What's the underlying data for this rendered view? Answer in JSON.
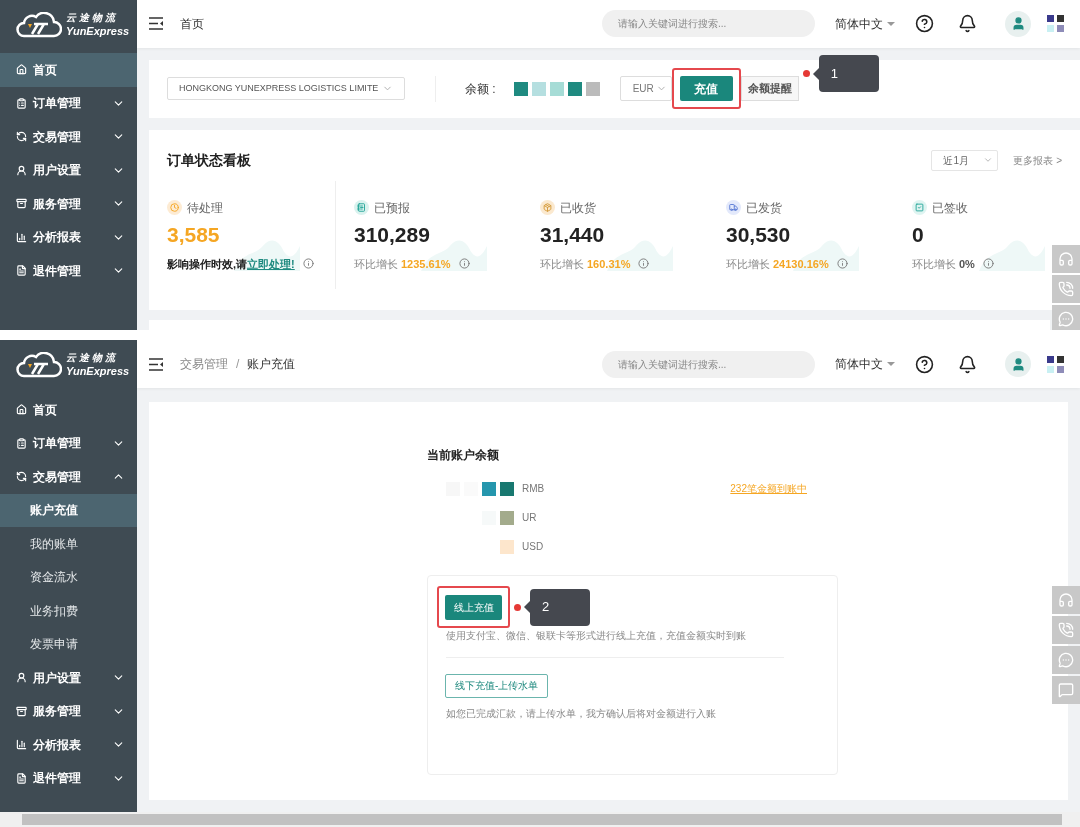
{
  "home_screen": {
    "logo": {
      "name_cn": "云途物流",
      "name_en": "YunExpress"
    },
    "sidebar": [
      {
        "label": "首页",
        "selected": true
      },
      {
        "label": "订单管理",
        "selected": false,
        "expanded": false
      },
      {
        "label": "交易管理",
        "selected": false,
        "expanded": false
      },
      {
        "label": "用户设置",
        "selected": false,
        "expanded": false
      },
      {
        "label": "服务管理",
        "selected": false,
        "expanded": false
      },
      {
        "label": "分析报表",
        "selected": false,
        "expanded": false
      },
      {
        "label": "退件管理",
        "selected": false,
        "expanded": false
      }
    ],
    "header": {
      "breadcrumb": [
        "首页"
      ],
      "search": {
        "placeholder": "请输入关键词进行搜索..."
      },
      "language": "简体中文"
    },
    "account_bar": {
      "company": "HONGKONG YUNEXPRESS LOGISTICS LIMITE",
      "balance_label": "余额 :",
      "currency": "EUR",
      "recharge_button": {
        "label": "充值",
        "highlighted": true
      },
      "reminder_button": "余额提醒",
      "callout": "1"
    },
    "dashboard": {
      "title": "订单状态看板",
      "period": "近1月",
      "more_link": "更多报表 >",
      "stats": [
        {
          "kind": "pending",
          "label": "待处理",
          "value": "3,585",
          "note": "影响操作时效,请",
          "link": "立即处理!"
        },
        {
          "kind": "growth",
          "label": "已预报",
          "value": "310,289",
          "growth_label": "环比增长",
          "growth": "1235.61%",
          "highlighted": true
        },
        {
          "kind": "growth",
          "label": "已收货",
          "value": "31,440",
          "growth_label": "环比增长",
          "growth": "160.31%",
          "highlighted": true
        },
        {
          "kind": "growth",
          "label": "已发货",
          "value": "30,530",
          "growth_label": "环比增长",
          "growth": "24130.16%",
          "highlighted": true
        },
        {
          "kind": "growth",
          "label": "已签收",
          "value": "0",
          "growth_label": "环比增长",
          "growth": "0%",
          "highlighted": false
        }
      ]
    }
  },
  "recharge_screen": {
    "logo": {
      "name_cn": "云途物流",
      "name_en": "YunExpress"
    },
    "sidebar": [
      {
        "label": "首页",
        "selected": false
      },
      {
        "label": "订单管理",
        "selected": false,
        "expanded": false
      },
      {
        "label": "交易管理",
        "selected": false,
        "expanded": true,
        "children": [
          {
            "label": "账户充值",
            "selected": true
          },
          {
            "label": "我的账单",
            "selected": false
          },
          {
            "label": "资金流水",
            "selected": false
          },
          {
            "label": "业务扣费",
            "selected": false
          },
          {
            "label": "发票申请",
            "selected": false
          }
        ]
      },
      {
        "label": "用户设置",
        "selected": false,
        "expanded": false
      },
      {
        "label": "服务管理",
        "selected": false,
        "expanded": false
      },
      {
        "label": "分析报表",
        "selected": false,
        "expanded": false
      },
      {
        "label": "退件管理",
        "selected": false,
        "expanded": false
      }
    ],
    "header": {
      "breadcrumb": [
        "交易管理",
        "账户充值"
      ],
      "breadcrumb_separator": "/",
      "search": {
        "placeholder": "请输入关键词进行搜索..."
      },
      "language": "简体中文"
    },
    "balance": {
      "title": "当前账户余额",
      "pending_link": "232笔金额到账中",
      "rows": [
        {
          "currency": "RMB"
        },
        {
          "currency": "UR"
        },
        {
          "currency": "USD"
        }
      ]
    },
    "online": {
      "button": {
        "label": "线上充值",
        "highlighted": true
      },
      "callout": "2",
      "description": "使用支付宝、微信、银联卡等形式进行线上充值，充值金额实时到账"
    },
    "offline": {
      "button": {
        "label": "线下充值-上传水单"
      },
      "description": "如您已完成汇款，请上传水单，我方确认后将对金额进行入账"
    }
  }
}
